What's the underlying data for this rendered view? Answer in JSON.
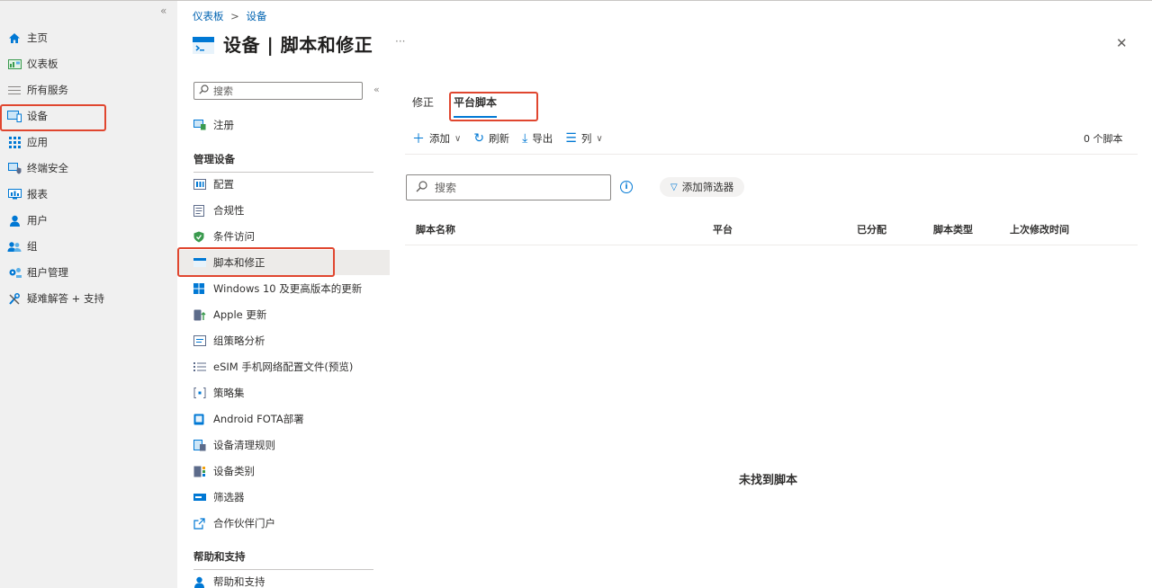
{
  "nav": {
    "collapse": "«",
    "items": [
      {
        "label": "主页"
      },
      {
        "label": "仪表板"
      },
      {
        "label": "所有服务"
      },
      {
        "label": "设备"
      },
      {
        "label": "应用"
      },
      {
        "label": "终端安全"
      },
      {
        "label": "报表"
      },
      {
        "label": "用户"
      },
      {
        "label": "组"
      },
      {
        "label": "租户管理"
      },
      {
        "label": "疑难解答 + 支持"
      }
    ]
  },
  "breadcrumb": {
    "items": [
      "仪表板",
      "设备"
    ],
    "sep": ">"
  },
  "header": {
    "title": "设备 | 脚本和修正",
    "more": "···",
    "close": "✕"
  },
  "menu": {
    "search_placeholder": "搜索",
    "collapse": "«",
    "register": "注册",
    "section_manage": "管理设备",
    "items": [
      "配置",
      "合规性",
      "条件访问",
      "脚本和修正",
      "Windows 10 及更高版本的更新",
      "Apple 更新",
      "组策略分析",
      "eSIM 手机网络配置文件(预览)",
      "策略集",
      "Android FOTA部署",
      "设备清理规则",
      "设备类别",
      "筛选器",
      "合作伙伴门户"
    ],
    "section_help": "帮助和支持",
    "help_item": "帮助和支持"
  },
  "tabs": [
    "修正",
    "平台脚本"
  ],
  "toolbar": {
    "add": "添加",
    "refresh": "刷新",
    "export": "导出",
    "columns": "列",
    "count": "0 个脚本"
  },
  "search": {
    "placeholder": "搜索",
    "filter": "添加筛选器"
  },
  "table": {
    "columns": [
      "脚本名称",
      "平台",
      "已分配",
      "脚本类型",
      "上次修改时间"
    ],
    "empty": "未找到脚本"
  },
  "colors": {
    "accent": "#0078d4",
    "highlight": "#e0462f"
  }
}
